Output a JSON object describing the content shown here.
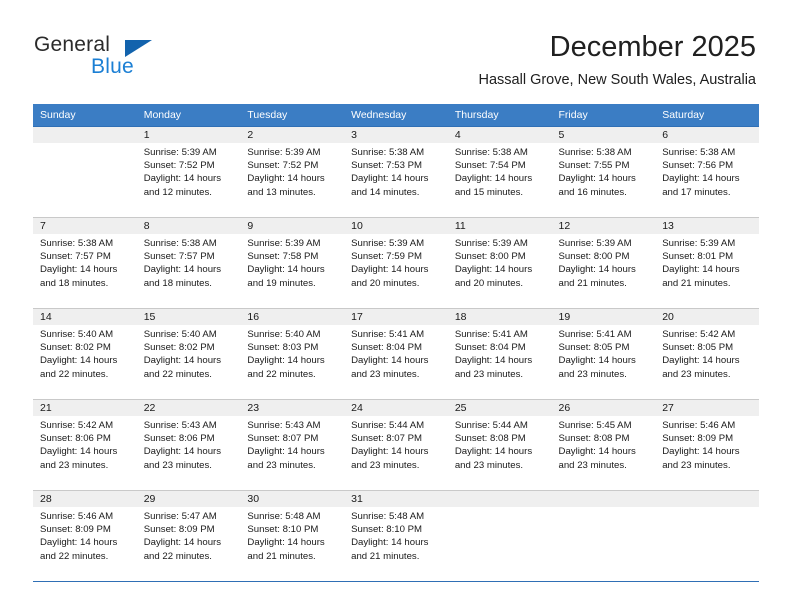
{
  "brand": {
    "word_general": "General",
    "word_blue": "Blue",
    "triangle_color": "#1263ad",
    "blue_color": "#1b7fd4"
  },
  "header": {
    "month_title": "December 2025",
    "location": "Hassall Grove, New South Wales, Australia"
  },
  "theme": {
    "header_row_bg": "#3b7dc4",
    "daynum_bg": "#efefef",
    "grid_line_top": "#2f6fb5",
    "grid_line_bottom": "#c9c9c9"
  },
  "calendar": {
    "weekday_headers": [
      "Sunday",
      "Monday",
      "Tuesday",
      "Wednesday",
      "Thursday",
      "Friday",
      "Saturday"
    ],
    "weeks": [
      [
        {
          "day": "",
          "sunrise": "",
          "sunset": "",
          "daylight_1": "",
          "daylight_2": "",
          "blank": true
        },
        {
          "day": "1",
          "sunrise": "Sunrise: 5:39 AM",
          "sunset": "Sunset: 7:52 PM",
          "daylight_1": "Daylight: 14 hours",
          "daylight_2": "and 12 minutes."
        },
        {
          "day": "2",
          "sunrise": "Sunrise: 5:39 AM",
          "sunset": "Sunset: 7:52 PM",
          "daylight_1": "Daylight: 14 hours",
          "daylight_2": "and 13 minutes."
        },
        {
          "day": "3",
          "sunrise": "Sunrise: 5:38 AM",
          "sunset": "Sunset: 7:53 PM",
          "daylight_1": "Daylight: 14 hours",
          "daylight_2": "and 14 minutes."
        },
        {
          "day": "4",
          "sunrise": "Sunrise: 5:38 AM",
          "sunset": "Sunset: 7:54 PM",
          "daylight_1": "Daylight: 14 hours",
          "daylight_2": "and 15 minutes."
        },
        {
          "day": "5",
          "sunrise": "Sunrise: 5:38 AM",
          "sunset": "Sunset: 7:55 PM",
          "daylight_1": "Daylight: 14 hours",
          "daylight_2": "and 16 minutes."
        },
        {
          "day": "6",
          "sunrise": "Sunrise: 5:38 AM",
          "sunset": "Sunset: 7:56 PM",
          "daylight_1": "Daylight: 14 hours",
          "daylight_2": "and 17 minutes."
        }
      ],
      [
        {
          "day": "7",
          "sunrise": "Sunrise: 5:38 AM",
          "sunset": "Sunset: 7:57 PM",
          "daylight_1": "Daylight: 14 hours",
          "daylight_2": "and 18 minutes."
        },
        {
          "day": "8",
          "sunrise": "Sunrise: 5:38 AM",
          "sunset": "Sunset: 7:57 PM",
          "daylight_1": "Daylight: 14 hours",
          "daylight_2": "and 18 minutes."
        },
        {
          "day": "9",
          "sunrise": "Sunrise: 5:39 AM",
          "sunset": "Sunset: 7:58 PM",
          "daylight_1": "Daylight: 14 hours",
          "daylight_2": "and 19 minutes."
        },
        {
          "day": "10",
          "sunrise": "Sunrise: 5:39 AM",
          "sunset": "Sunset: 7:59 PM",
          "daylight_1": "Daylight: 14 hours",
          "daylight_2": "and 20 minutes."
        },
        {
          "day": "11",
          "sunrise": "Sunrise: 5:39 AM",
          "sunset": "Sunset: 8:00 PM",
          "daylight_1": "Daylight: 14 hours",
          "daylight_2": "and 20 minutes."
        },
        {
          "day": "12",
          "sunrise": "Sunrise: 5:39 AM",
          "sunset": "Sunset: 8:00 PM",
          "daylight_1": "Daylight: 14 hours",
          "daylight_2": "and 21 minutes."
        },
        {
          "day": "13",
          "sunrise": "Sunrise: 5:39 AM",
          "sunset": "Sunset: 8:01 PM",
          "daylight_1": "Daylight: 14 hours",
          "daylight_2": "and 21 minutes."
        }
      ],
      [
        {
          "day": "14",
          "sunrise": "Sunrise: 5:40 AM",
          "sunset": "Sunset: 8:02 PM",
          "daylight_1": "Daylight: 14 hours",
          "daylight_2": "and 22 minutes."
        },
        {
          "day": "15",
          "sunrise": "Sunrise: 5:40 AM",
          "sunset": "Sunset: 8:02 PM",
          "daylight_1": "Daylight: 14 hours",
          "daylight_2": "and 22 minutes."
        },
        {
          "day": "16",
          "sunrise": "Sunrise: 5:40 AM",
          "sunset": "Sunset: 8:03 PM",
          "daylight_1": "Daylight: 14 hours",
          "daylight_2": "and 22 minutes."
        },
        {
          "day": "17",
          "sunrise": "Sunrise: 5:41 AM",
          "sunset": "Sunset: 8:04 PM",
          "daylight_1": "Daylight: 14 hours",
          "daylight_2": "and 23 minutes."
        },
        {
          "day": "18",
          "sunrise": "Sunrise: 5:41 AM",
          "sunset": "Sunset: 8:04 PM",
          "daylight_1": "Daylight: 14 hours",
          "daylight_2": "and 23 minutes."
        },
        {
          "day": "19",
          "sunrise": "Sunrise: 5:41 AM",
          "sunset": "Sunset: 8:05 PM",
          "daylight_1": "Daylight: 14 hours",
          "daylight_2": "and 23 minutes."
        },
        {
          "day": "20",
          "sunrise": "Sunrise: 5:42 AM",
          "sunset": "Sunset: 8:05 PM",
          "daylight_1": "Daylight: 14 hours",
          "daylight_2": "and 23 minutes."
        }
      ],
      [
        {
          "day": "21",
          "sunrise": "Sunrise: 5:42 AM",
          "sunset": "Sunset: 8:06 PM",
          "daylight_1": "Daylight: 14 hours",
          "daylight_2": "and 23 minutes."
        },
        {
          "day": "22",
          "sunrise": "Sunrise: 5:43 AM",
          "sunset": "Sunset: 8:06 PM",
          "daylight_1": "Daylight: 14 hours",
          "daylight_2": "and 23 minutes."
        },
        {
          "day": "23",
          "sunrise": "Sunrise: 5:43 AM",
          "sunset": "Sunset: 8:07 PM",
          "daylight_1": "Daylight: 14 hours",
          "daylight_2": "and 23 minutes."
        },
        {
          "day": "24",
          "sunrise": "Sunrise: 5:44 AM",
          "sunset": "Sunset: 8:07 PM",
          "daylight_1": "Daylight: 14 hours",
          "daylight_2": "and 23 minutes."
        },
        {
          "day": "25",
          "sunrise": "Sunrise: 5:44 AM",
          "sunset": "Sunset: 8:08 PM",
          "daylight_1": "Daylight: 14 hours",
          "daylight_2": "and 23 minutes."
        },
        {
          "day": "26",
          "sunrise": "Sunrise: 5:45 AM",
          "sunset": "Sunset: 8:08 PM",
          "daylight_1": "Daylight: 14 hours",
          "daylight_2": "and 23 minutes."
        },
        {
          "day": "27",
          "sunrise": "Sunrise: 5:46 AM",
          "sunset": "Sunset: 8:09 PM",
          "daylight_1": "Daylight: 14 hours",
          "daylight_2": "and 23 minutes."
        }
      ],
      [
        {
          "day": "28",
          "sunrise": "Sunrise: 5:46 AM",
          "sunset": "Sunset: 8:09 PM",
          "daylight_1": "Daylight: 14 hours",
          "daylight_2": "and 22 minutes."
        },
        {
          "day": "29",
          "sunrise": "Sunrise: 5:47 AM",
          "sunset": "Sunset: 8:09 PM",
          "daylight_1": "Daylight: 14 hours",
          "daylight_2": "and 22 minutes."
        },
        {
          "day": "30",
          "sunrise": "Sunrise: 5:48 AM",
          "sunset": "Sunset: 8:10 PM",
          "daylight_1": "Daylight: 14 hours",
          "daylight_2": "and 21 minutes."
        },
        {
          "day": "31",
          "sunrise": "Sunrise: 5:48 AM",
          "sunset": "Sunset: 8:10 PM",
          "daylight_1": "Daylight: 14 hours",
          "daylight_2": "and 21 minutes."
        },
        {
          "day": "",
          "sunrise": "",
          "sunset": "",
          "daylight_1": "",
          "daylight_2": "",
          "blank": true
        },
        {
          "day": "",
          "sunrise": "",
          "sunset": "",
          "daylight_1": "",
          "daylight_2": "",
          "blank": true
        },
        {
          "day": "",
          "sunrise": "",
          "sunset": "",
          "daylight_1": "",
          "daylight_2": "",
          "blank": true
        }
      ]
    ]
  }
}
